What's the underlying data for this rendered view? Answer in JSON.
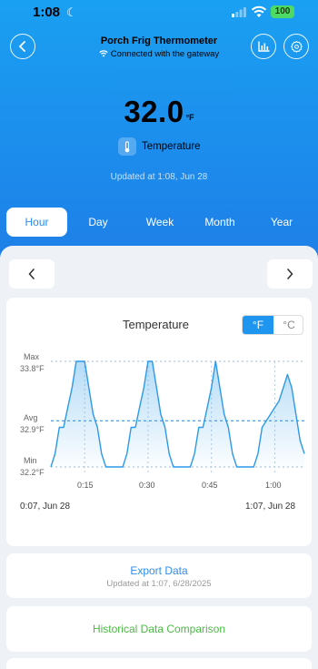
{
  "status_bar": {
    "time": "1:08",
    "battery": "100"
  },
  "header": {
    "title": "Porch Frig Thermometer",
    "subtitle": "Connected with the gateway"
  },
  "reading": {
    "value": "32.0",
    "unit": "°F",
    "metric_label": "Temperature",
    "updated": "Updated at 1:08,  Jun 28"
  },
  "tabs": [
    {
      "label": "Hour",
      "active": true
    },
    {
      "label": "Day",
      "active": false
    },
    {
      "label": "Week",
      "active": false
    },
    {
      "label": "Month",
      "active": false
    },
    {
      "label": "Year",
      "active": false
    }
  ],
  "chart_card": {
    "title": "Temperature",
    "unit_f": "°F",
    "unit_c": "°C",
    "range_start": "0:07,  Jun 28",
    "range_end": "1:07,  Jun 28"
  },
  "chart_data": {
    "type": "area",
    "title": "Temperature",
    "y_labels": {
      "max_label": "Max",
      "max_value": "33.8°F",
      "avg_label": "Avg",
      "avg_value": "32.9°F",
      "min_label": "Min",
      "min_value": "32.2°F"
    },
    "ylim": [
      32.2,
      33.8
    ],
    "x_ticks": [
      "0:15",
      "0:30",
      "0:45",
      "1:00"
    ],
    "x_minutes": [
      7,
      8,
      9,
      10,
      11,
      12,
      13,
      14,
      15,
      16,
      17,
      18,
      19,
      20,
      21,
      22,
      23,
      24,
      25,
      26,
      27,
      28,
      29,
      30,
      31,
      32,
      33,
      34,
      35,
      36,
      37,
      38,
      39,
      40,
      41,
      42,
      43,
      44,
      45,
      46,
      47,
      48,
      49,
      50,
      51,
      52,
      53,
      54,
      55,
      56,
      57,
      58,
      59,
      60,
      61,
      62,
      63,
      64,
      65,
      66,
      67
    ],
    "values": [
      32.2,
      32.4,
      32.8,
      32.8,
      33.1,
      33.4,
      33.8,
      33.8,
      33.8,
      33.4,
      33.0,
      32.8,
      32.4,
      32.2,
      32.2,
      32.2,
      32.2,
      32.2,
      32.4,
      32.8,
      32.8,
      33.1,
      33.4,
      33.8,
      33.8,
      33.4,
      33.0,
      32.8,
      32.4,
      32.2,
      32.2,
      32.2,
      32.2,
      32.2,
      32.4,
      32.8,
      32.8,
      33.1,
      33.4,
      33.8,
      33.4,
      33.0,
      32.8,
      32.4,
      32.2,
      32.2,
      32.2,
      32.2,
      32.2,
      32.4,
      32.8,
      32.9,
      33.0,
      33.1,
      33.2,
      33.4,
      33.6,
      33.4,
      33.0,
      32.6,
      32.4
    ],
    "avg_line": 32.9,
    "color": "#2c9ae8",
    "grid": false
  },
  "export": {
    "title": "Export Data",
    "updated": "Updated at 1:07,  6/28/2025"
  },
  "history": {
    "title": "Historical Data Comparison"
  }
}
